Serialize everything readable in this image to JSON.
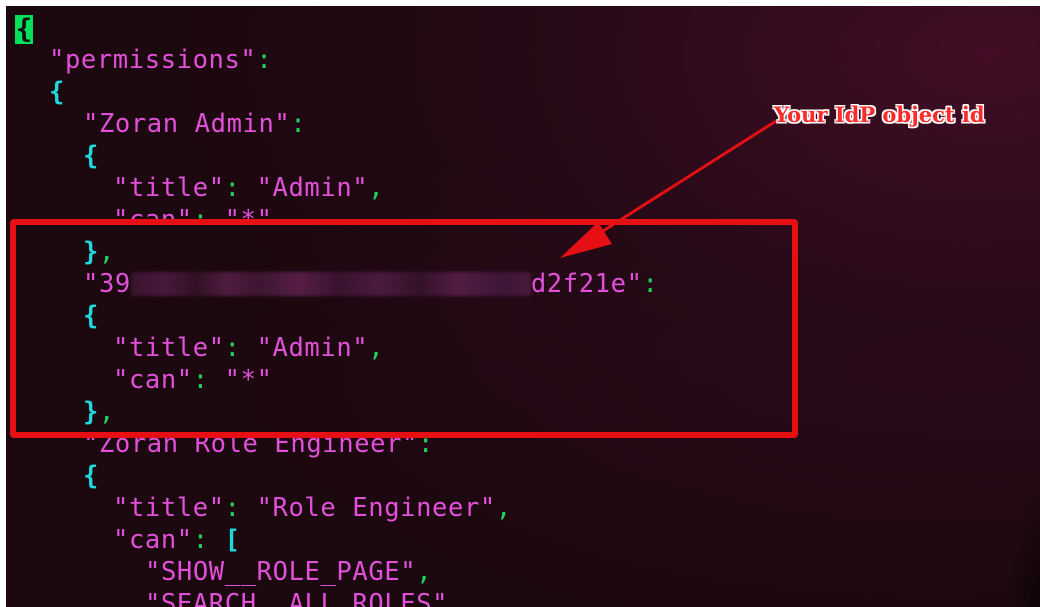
{
  "annotation": {
    "label": "Your IdP object id",
    "color": "#e60f14"
  },
  "cursor_char": "{",
  "colors": {
    "background": "#1c080f",
    "string": "#e24fd9",
    "punctuation": "#22d35b",
    "brace": "#20d7e0",
    "cursor": "#00e05a"
  },
  "code": {
    "l1": "\"permissions\"",
    "l3": "\"Zoran Admin\"",
    "l5_key": "\"title\"",
    "l5_val": "\"Admin\"",
    "l6_key": "\"can\"",
    "l6_val": "\"*\"",
    "l8_prefix": "\"39",
    "l8_suffix": "d2f21e\"",
    "l10_key": "\"title\"",
    "l10_val": "\"Admin\"",
    "l11_key": "\"can\"",
    "l11_val": "\"*\"",
    "l13": "\"Zoran Role Engineer\"",
    "l15_key": "\"title\"",
    "l15_val": "\"Role Engineer\"",
    "l16_key": "\"can\"",
    "l17": "\"SHOW__ROLE_PAGE\"",
    "l18": "\"SEARCH__ALL_ROLES\""
  }
}
